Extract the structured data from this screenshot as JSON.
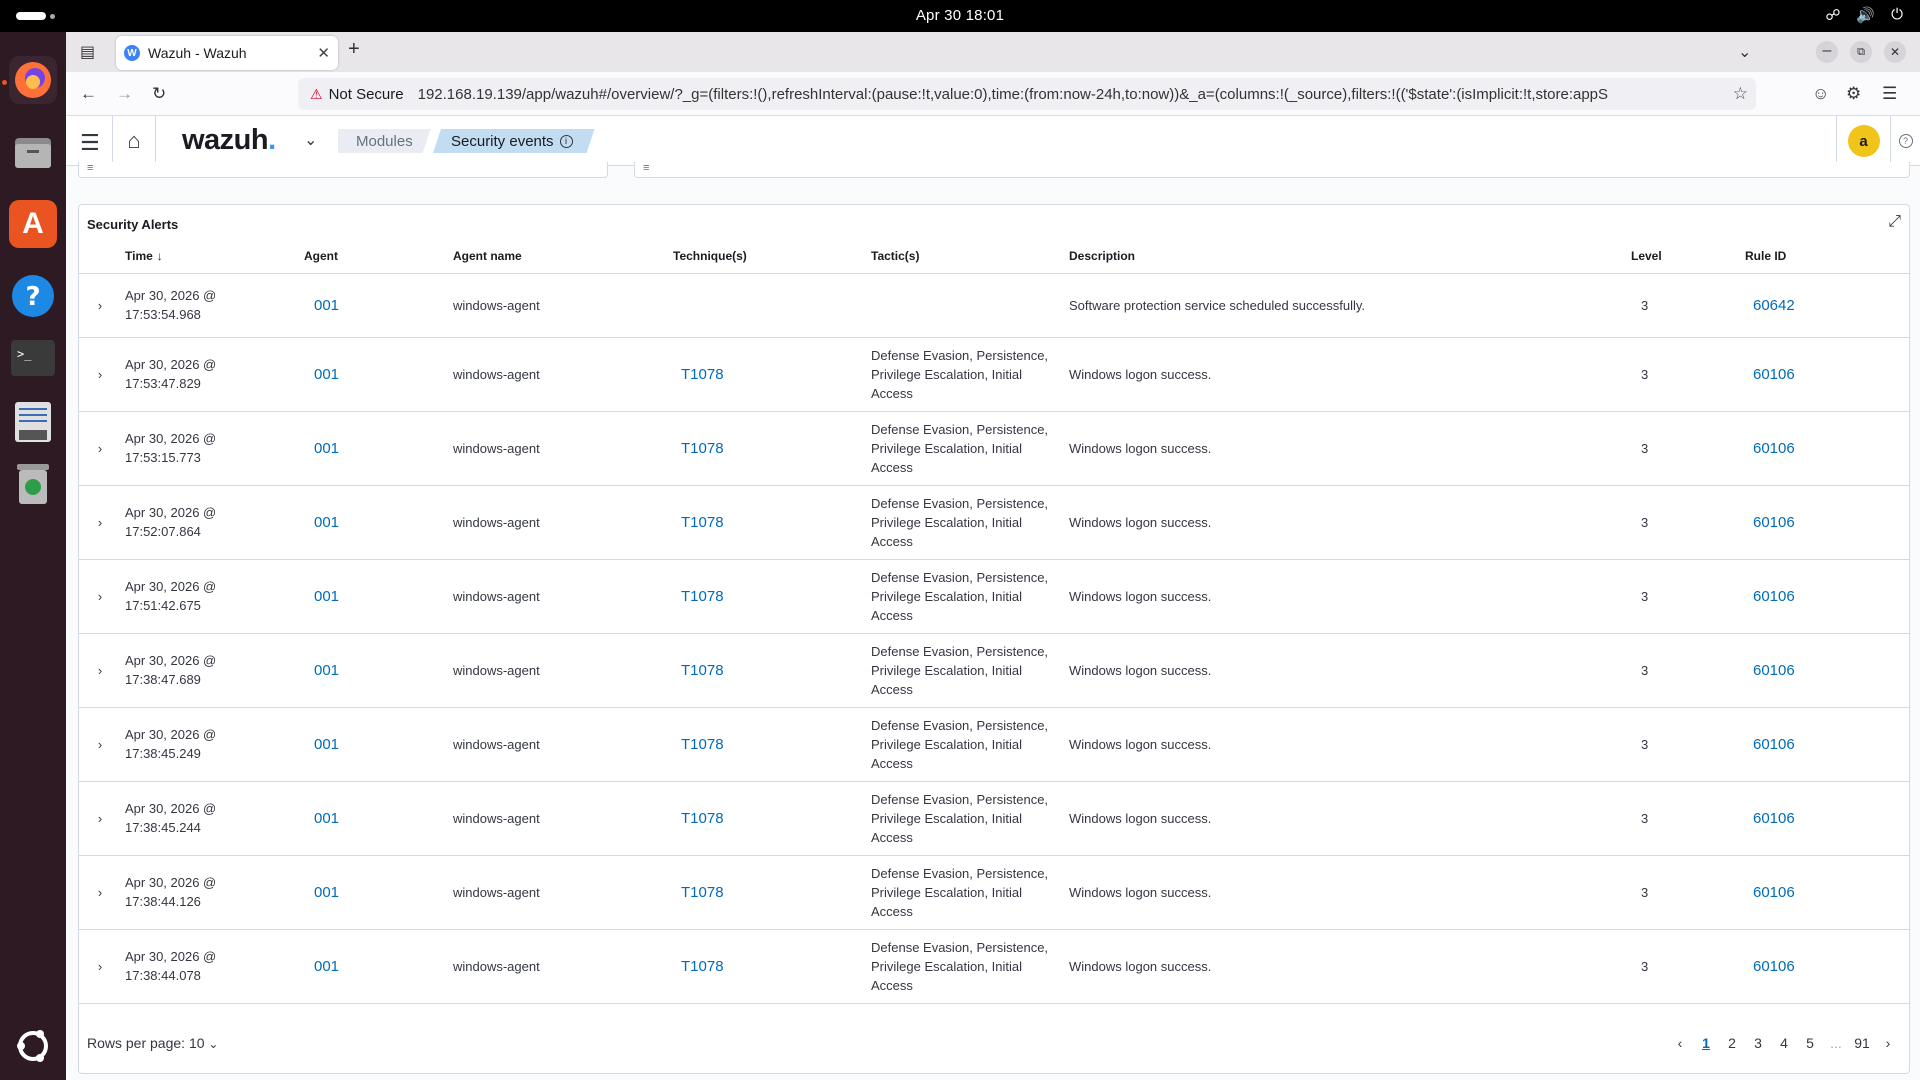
{
  "system": {
    "clock": "Apr 30  18:01"
  },
  "browser": {
    "tab_title": "Wazuh - Wazuh",
    "not_secure": "Not Secure",
    "url": "192.168.19.139/app/wazuh#/overview/?_g=(filters:!(),refreshInterval:(pause:!t,value:0),time:(from:now-24h,to:now))&_a=(columns:!(_source),filters:!(('$state':(isImplicit:!t,store:appS"
  },
  "header": {
    "logo": "wazuh",
    "logo_dot": ".",
    "breadcrumb_modules": "Modules",
    "breadcrumb_active": "Security events",
    "avatar_initial": "a"
  },
  "panel": {
    "title": "Security Alerts"
  },
  "table": {
    "columns": {
      "time": "Time",
      "agent": "Agent",
      "agent_name": "Agent name",
      "techniques": "Technique(s)",
      "tactics": "Tactic(s)",
      "description": "Description",
      "level": "Level",
      "rule_id": "Rule ID"
    },
    "rows": [
      {
        "date": "Apr 30, 2026 @",
        "time": "17:53:54.968",
        "agent": "001",
        "agent_name": "windows-agent",
        "technique": "",
        "tactics": "",
        "description": "Software protection service scheduled successfully.",
        "level": "3",
        "rule_id": "60642"
      },
      {
        "date": "Apr 30, 2026 @",
        "time": "17:53:47.829",
        "agent": "001",
        "agent_name": "windows-agent",
        "technique": "T1078",
        "tactics": "Defense Evasion, Persistence, Privilege Escalation, Initial Access",
        "description": "Windows logon success.",
        "level": "3",
        "rule_id": "60106"
      },
      {
        "date": "Apr 30, 2026 @",
        "time": "17:53:15.773",
        "agent": "001",
        "agent_name": "windows-agent",
        "technique": "T1078",
        "tactics": "Defense Evasion, Persistence, Privilege Escalation, Initial Access",
        "description": "Windows logon success.",
        "level": "3",
        "rule_id": "60106"
      },
      {
        "date": "Apr 30, 2026 @",
        "time": "17:52:07.864",
        "agent": "001",
        "agent_name": "windows-agent",
        "technique": "T1078",
        "tactics": "Defense Evasion, Persistence, Privilege Escalation, Initial Access",
        "description": "Windows logon success.",
        "level": "3",
        "rule_id": "60106"
      },
      {
        "date": "Apr 30, 2026 @",
        "time": "17:51:42.675",
        "agent": "001",
        "agent_name": "windows-agent",
        "technique": "T1078",
        "tactics": "Defense Evasion, Persistence, Privilege Escalation, Initial Access",
        "description": "Windows logon success.",
        "level": "3",
        "rule_id": "60106"
      },
      {
        "date": "Apr 30, 2026 @",
        "time": "17:38:47.689",
        "agent": "001",
        "agent_name": "windows-agent",
        "technique": "T1078",
        "tactics": "Defense Evasion, Persistence, Privilege Escalation, Initial Access",
        "description": "Windows logon success.",
        "level": "3",
        "rule_id": "60106"
      },
      {
        "date": "Apr 30, 2026 @",
        "time": "17:38:45.249",
        "agent": "001",
        "agent_name": "windows-agent",
        "technique": "T1078",
        "tactics": "Defense Evasion, Persistence, Privilege Escalation, Initial Access",
        "description": "Windows logon success.",
        "level": "3",
        "rule_id": "60106"
      },
      {
        "date": "Apr 30, 2026 @",
        "time": "17:38:45.244",
        "agent": "001",
        "agent_name": "windows-agent",
        "technique": "T1078",
        "tactics": "Defense Evasion, Persistence, Privilege Escalation, Initial Access",
        "description": "Windows logon success.",
        "level": "3",
        "rule_id": "60106"
      },
      {
        "date": "Apr 30, 2026 @",
        "time": "17:38:44.126",
        "agent": "001",
        "agent_name": "windows-agent",
        "technique": "T1078",
        "tactics": "Defense Evasion, Persistence, Privilege Escalation, Initial Access",
        "description": "Windows logon success.",
        "level": "3",
        "rule_id": "60106"
      },
      {
        "date": "Apr 30, 2026 @",
        "time": "17:38:44.078",
        "agent": "001",
        "agent_name": "windows-agent",
        "technique": "T1078",
        "tactics": "Defense Evasion, Persistence, Privilege Escalation, Initial Access",
        "description": "Windows logon success.",
        "level": "3",
        "rule_id": "60106"
      }
    ]
  },
  "pagination": {
    "rows_per_page": "Rows per page: 10",
    "pages": [
      "1",
      "2",
      "3",
      "4",
      "5"
    ],
    "ellipsis": "...",
    "last_page": "91"
  },
  "colors": {
    "link": "#006bb8",
    "breadcrumb_active": "#c2dcf2",
    "avatar": "#f0c419",
    "dock": "#2d1a23"
  },
  "icons": [
    "activities-icon",
    "network-icon",
    "volume-icon",
    "power-icon",
    "firefox-icon",
    "files-icon",
    "app-center-icon",
    "help-icon",
    "terminal-icon",
    "text-editor-icon",
    "trash-icon",
    "ubuntu-apps-icon",
    "tab-overview-icon",
    "wazuh-favicon",
    "close-icon",
    "new-tab-icon",
    "tab-list-icon",
    "minimize-icon",
    "restore-icon",
    "window-close-icon",
    "back-icon",
    "forward-icon",
    "reload-icon",
    "shield-icon",
    "star-icon",
    "account-icon",
    "extensions-icon",
    "menu-icon",
    "hamburger-icon",
    "home-icon",
    "chevron-down-icon",
    "info-icon",
    "expand-icon",
    "sort-down-icon",
    "chevron-right-icon",
    "chevron-left-icon"
  ]
}
